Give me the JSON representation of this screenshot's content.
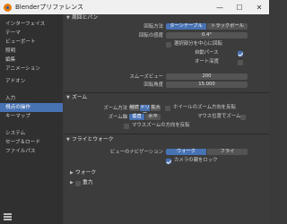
{
  "window": {
    "title": "Blenderプリファレンス",
    "minimize": "—",
    "maximize": "☐",
    "close": "✕"
  },
  "sidebar": {
    "group1": [
      "インターフェイス",
      "テーマ",
      "ビューポート",
      "照明",
      "編集",
      "アニメーション"
    ],
    "group2": [
      "アドオン"
    ],
    "group3": [
      "入力",
      "視点の操作",
      "キーマップ"
    ],
    "group4": [
      "システム",
      "セーブ＆ロード",
      "ファイルパス"
    ],
    "active": "視点の操作"
  },
  "orbit": {
    "header": "周回とパン",
    "orbit_method_label": "回転方法",
    "orbit_method_options": [
      "ターンテーブル",
      "トラックボール"
    ],
    "orbit_method_selected": "ターンテーブル",
    "sensitivity_label": "回転の感度",
    "sensitivity_value": "0.4°",
    "orbit_around_selection": "選択部分を中心に回転",
    "orbit_around_selection_checked": false,
    "auto_perspective": "自動パース",
    "auto_perspective_checked": true,
    "auto_depth": "オート深度",
    "auto_depth_checked": false,
    "smooth_view_label": "スムーズビュー",
    "smooth_view_value": "200",
    "rotation_angle_label": "回転角度",
    "rotation_angle_value": "15.000"
  },
  "zoom": {
    "header": "ズーム",
    "zoom_method_label": "ズーム方法",
    "zoom_method_options": [
      "継続",
      "ドリー",
      "拡大"
    ],
    "zoom_method_selected": "ドリー",
    "wheel_invert": "ホイールのズーム方向を反転",
    "wheel_invert_checked": false,
    "zoom_axis_label": "ズーム軸",
    "zoom_axis_options": [
      "垂直",
      "水平"
    ],
    "zoom_axis_selected": "垂直",
    "zoom_to_mouse": "マウス位置でズーム",
    "zoom_to_mouse_checked": false,
    "invert_mouse_zoom": "マウスズームの方向を反転",
    "invert_mouse_zoom_checked": false
  },
  "fly": {
    "header": "フライとウォーク",
    "nav_label": "ビューのナビゲーション",
    "nav_options": [
      "ウォーク",
      "フライ"
    ],
    "nav_selected": "ウォーク",
    "camera_lock": "カメラの親をロック",
    "camera_lock_checked": true,
    "walk_sub": "ウォーク",
    "gravity_sub": "重力",
    "gravity_checked": false
  },
  "colors": {
    "accent": "#4772b3",
    "sidebar_bg": "#303030",
    "main_bg": "#3c3c3c",
    "field_bg": "#545454"
  }
}
